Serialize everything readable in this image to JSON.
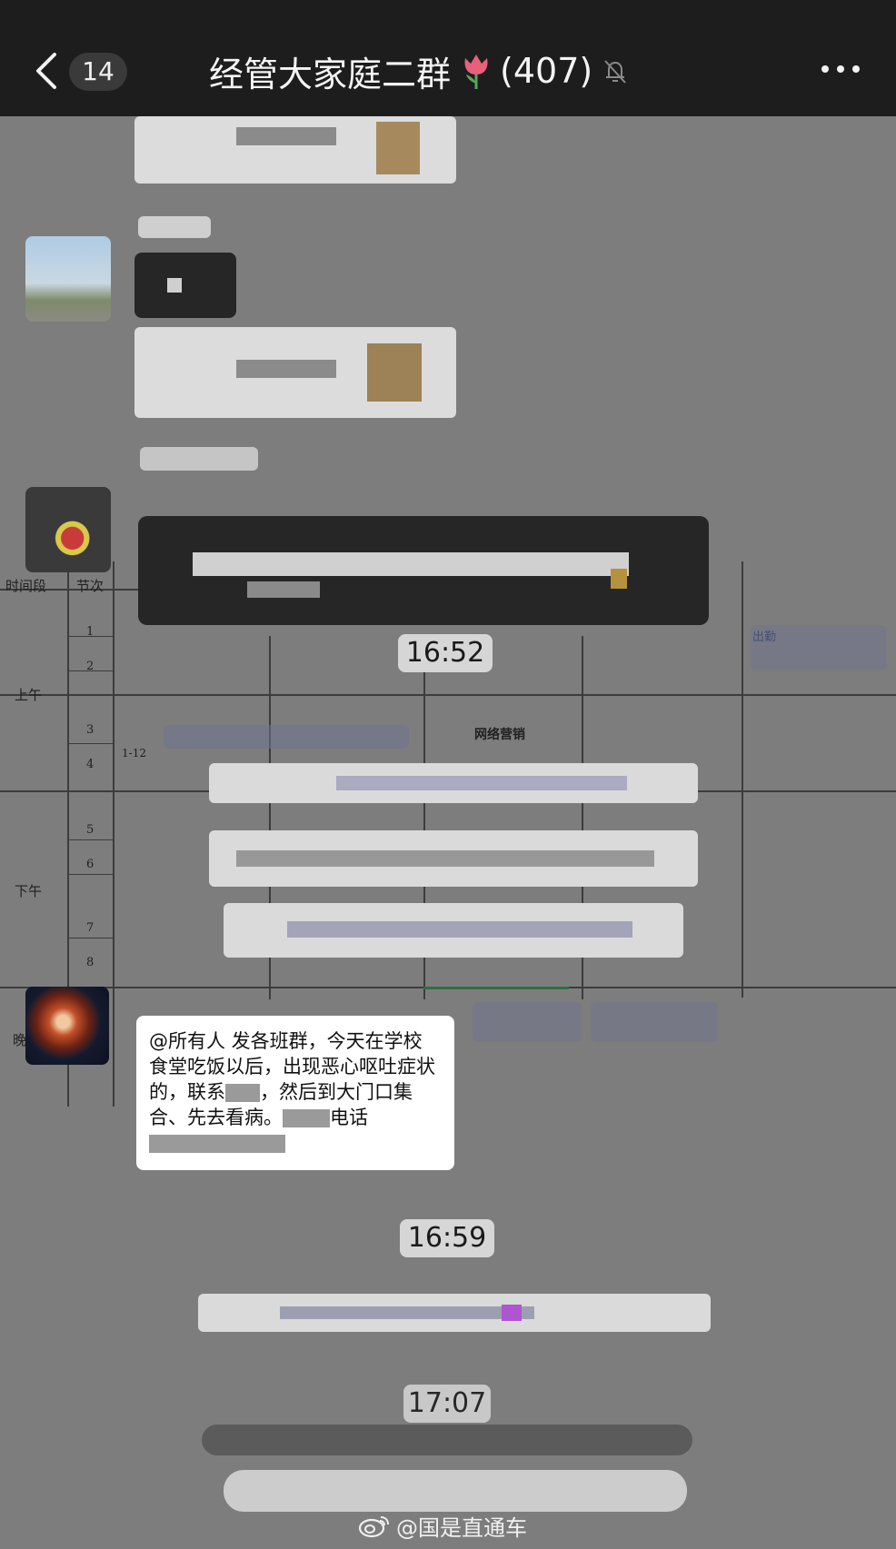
{
  "header": {
    "back_icon": "chevron-left-icon",
    "unread_count": "14",
    "title": "经管大家庭二群",
    "title_emoji_icon": "tulip-icon",
    "member_count": "(407)",
    "mute_icon": "bell-muted-icon",
    "more_icon": "more-dots-icon"
  },
  "timetable": {
    "col_time_period": "时间段",
    "col_session": "节次",
    "morning": "上午",
    "afternoon": "下午",
    "evening": "晚",
    "periods": [
      "1",
      "2",
      "3",
      "4",
      "5",
      "6",
      "7",
      "8"
    ],
    "course_a": "网络营销",
    "room_range": "1-12",
    "right_label": "出勤"
  },
  "timestamps": {
    "first": "16:52",
    "second": "16:59",
    "third": "17:07"
  },
  "announcement": {
    "line1": "@所有人   发各班群，今天在学校",
    "line2": "食堂吃饭以后，出现恶心呕吐症状",
    "line3_a": "的，联系",
    "line3_b": "，然后到大门口集",
    "line4_a": "合、先去看病。",
    "line4_b": "电话"
  },
  "watermark": {
    "icon": "weibo-icon",
    "text": "@国是直通车"
  },
  "colors": {
    "topbar": "#1d1d1d",
    "chat_bg": "#7d7d7d",
    "bubble": "#ffffff",
    "time_chip": "#d6d6d6"
  }
}
